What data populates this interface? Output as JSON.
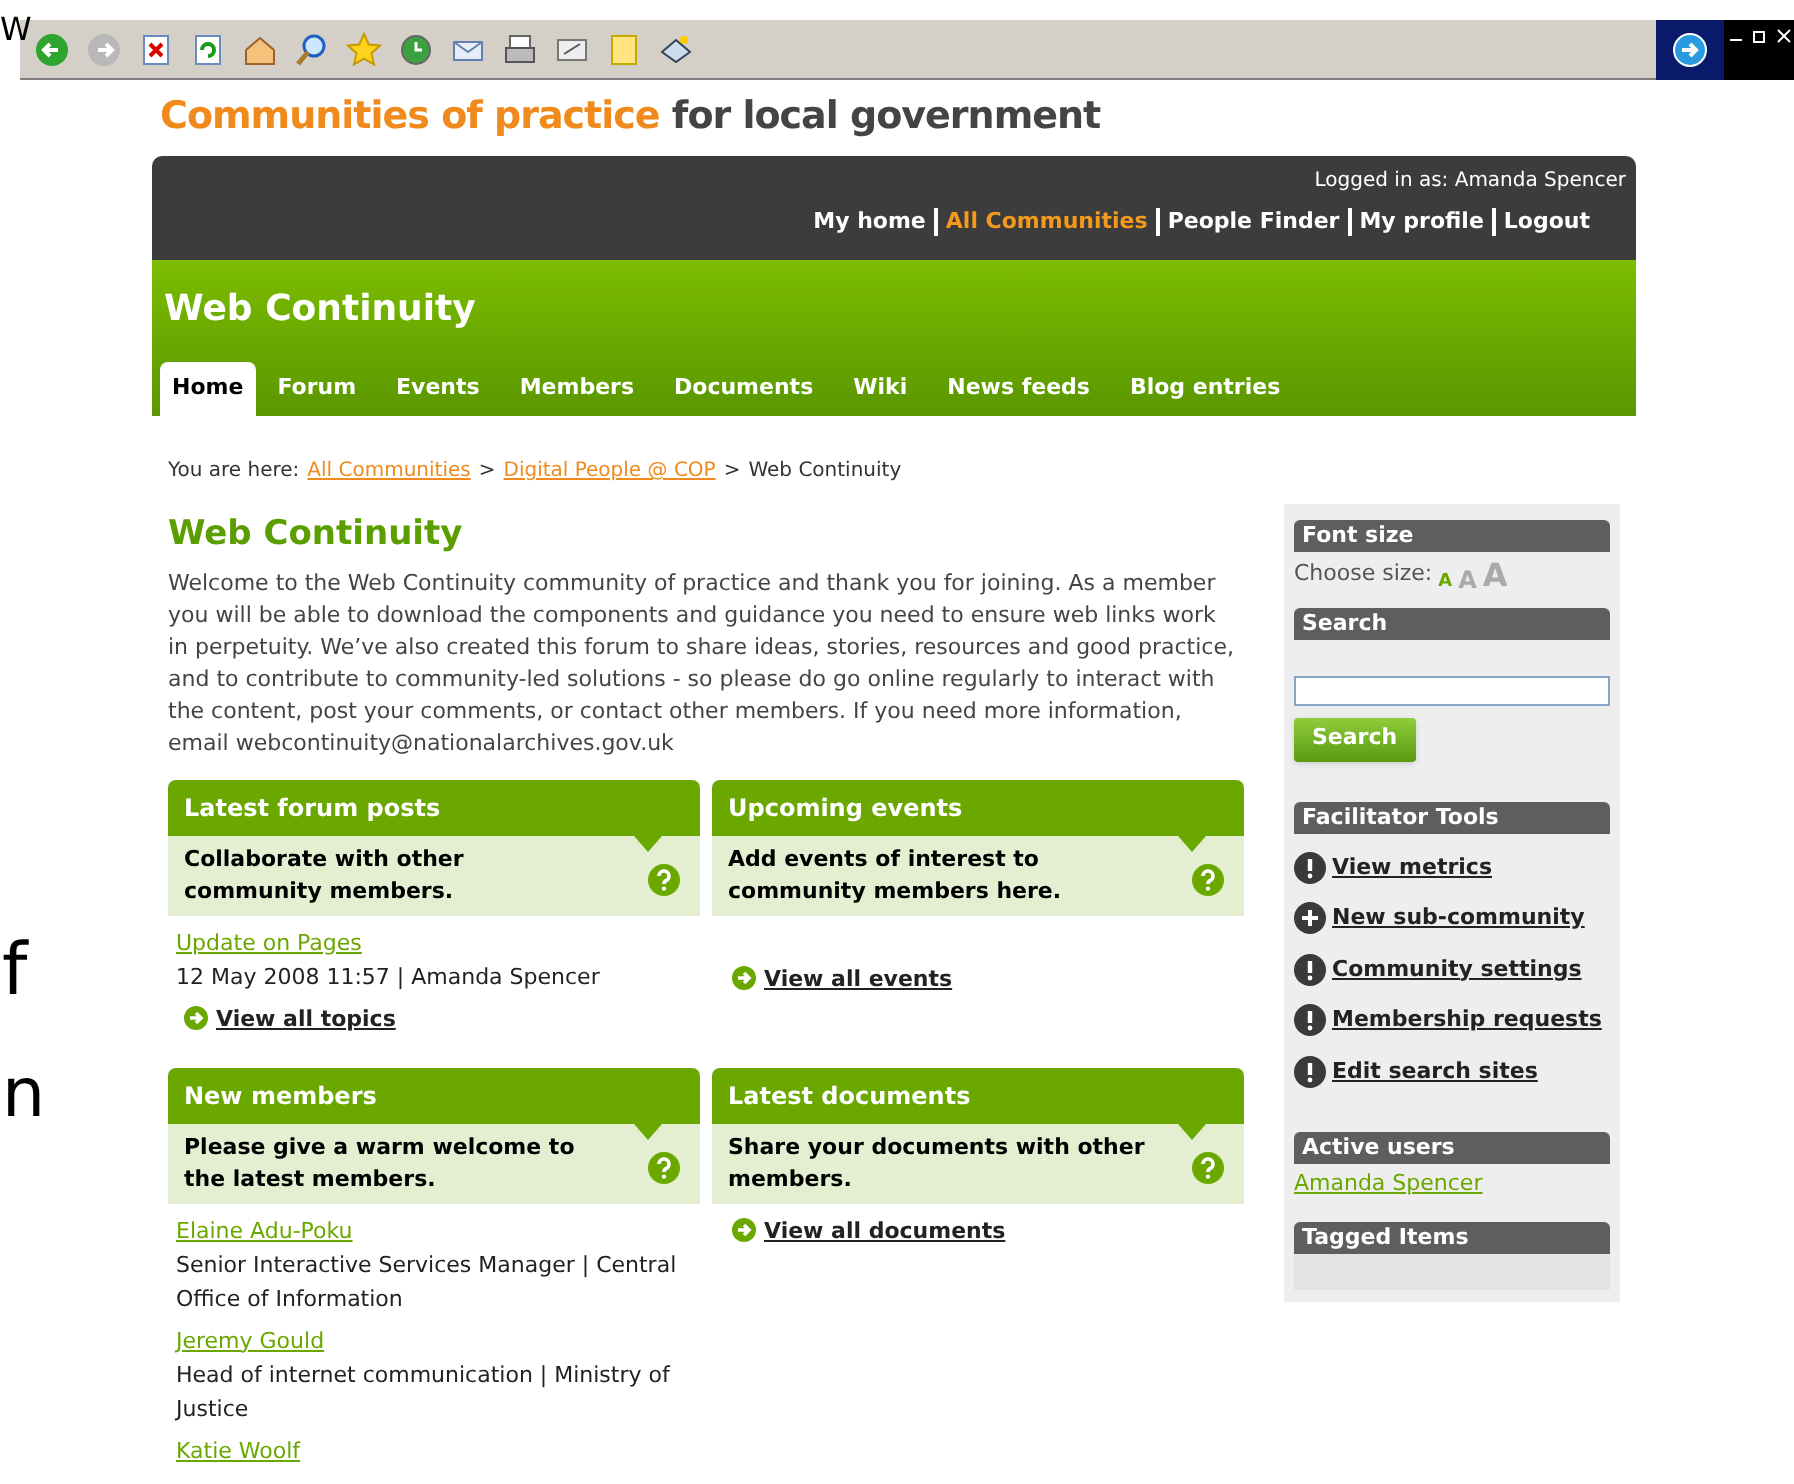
{
  "background_text": [
    "W",
    "f",
    "n"
  ],
  "site_title": {
    "highlight": "Communities of practice",
    "rest": "for local government"
  },
  "logged_in": "Logged in as: Amanda Spencer",
  "top_links": [
    {
      "label": "My home",
      "selected": false
    },
    {
      "label": "All Communities",
      "selected": true
    },
    {
      "label": "People Finder",
      "selected": false
    },
    {
      "label": "My profile",
      "selected": false
    },
    {
      "label": "Logout",
      "selected": false
    }
  ],
  "community_title": "Web Continuity",
  "tabs": [
    {
      "label": "Home",
      "selected": true
    },
    {
      "label": "Forum",
      "selected": false
    },
    {
      "label": "Events",
      "selected": false
    },
    {
      "label": "Members",
      "selected": false
    },
    {
      "label": "Documents",
      "selected": false
    },
    {
      "label": "Wiki",
      "selected": false
    },
    {
      "label": "News feeds",
      "selected": false
    },
    {
      "label": "Blog entries",
      "selected": false
    }
  ],
  "breadcrumb": {
    "prefix": "You are here:",
    "separator": ">",
    "items": [
      {
        "label": "All Communities",
        "kind": "link"
      },
      {
        "label": "Digital People @ COP",
        "kind": "link"
      },
      {
        "label": "Web Continuity",
        "kind": "current"
      }
    ]
  },
  "heading": "Web Continuity",
  "intro": "Welcome to the Web Continuity community of practice and thank you for joining. As a member you will be able to download the components and guidance you need to ensure web links work in perpetuity. We’ve also created this forum to share ideas, stories, resources and good practice, and to contribute to community-led solutions - so please do go online regularly to interact with the content, post your comments, or contact other members. If you need more information, email webcontinuity@nationalarchives.gov.uk",
  "panels": [
    {
      "title": "Latest forum posts",
      "description": "Collaborate with other community members.",
      "items": [
        {
          "link": "Update on Pages",
          "detail": "12 May 2008 11:57 | Amanda Spencer"
        }
      ],
      "more": "View all topics"
    },
    {
      "title": "Upcoming events",
      "description": "Add events of interest to community members here.",
      "more": "View all events"
    },
    {
      "title": "New members",
      "description": "Please give a warm welcome to the latest members.",
      "items": [
        {
          "link": "Elaine Adu-Poku",
          "detail": "Senior Interactive Services Manager | Central Office of Information"
        },
        {
          "link": "Jeremy Gould",
          "detail": "Head of internet communication | Ministry of Justice"
        },
        {
          "link": "Katie Woolf"
        }
      ]
    },
    {
      "title": "Latest documents",
      "description": "Share your documents with other members.",
      "more": "View all documents"
    }
  ],
  "sidebar": {
    "font_size": {
      "title": "Font size",
      "label": "Choose size:",
      "sizes": [
        {
          "label": "A",
          "selected": true
        },
        {
          "label": "A",
          "selected": false
        },
        {
          "label": "A",
          "selected": false
        }
      ]
    },
    "search": {
      "title": "Search",
      "button": "Search"
    },
    "facilitator": {
      "title": "Facilitator Tools",
      "items": [
        {
          "label": "View metrics",
          "kind": "alert"
        },
        {
          "label": "New sub-community",
          "kind": "add"
        },
        {
          "label": "Community settings",
          "kind": "alert"
        },
        {
          "label": "Membership requests",
          "kind": "alert"
        },
        {
          "label": "Edit search sites",
          "kind": "alert"
        }
      ]
    },
    "active_users": {
      "title": "Active users",
      "users": [
        "Amanda Spencer"
      ]
    },
    "tagged": {
      "title": "Tagged Items"
    }
  }
}
